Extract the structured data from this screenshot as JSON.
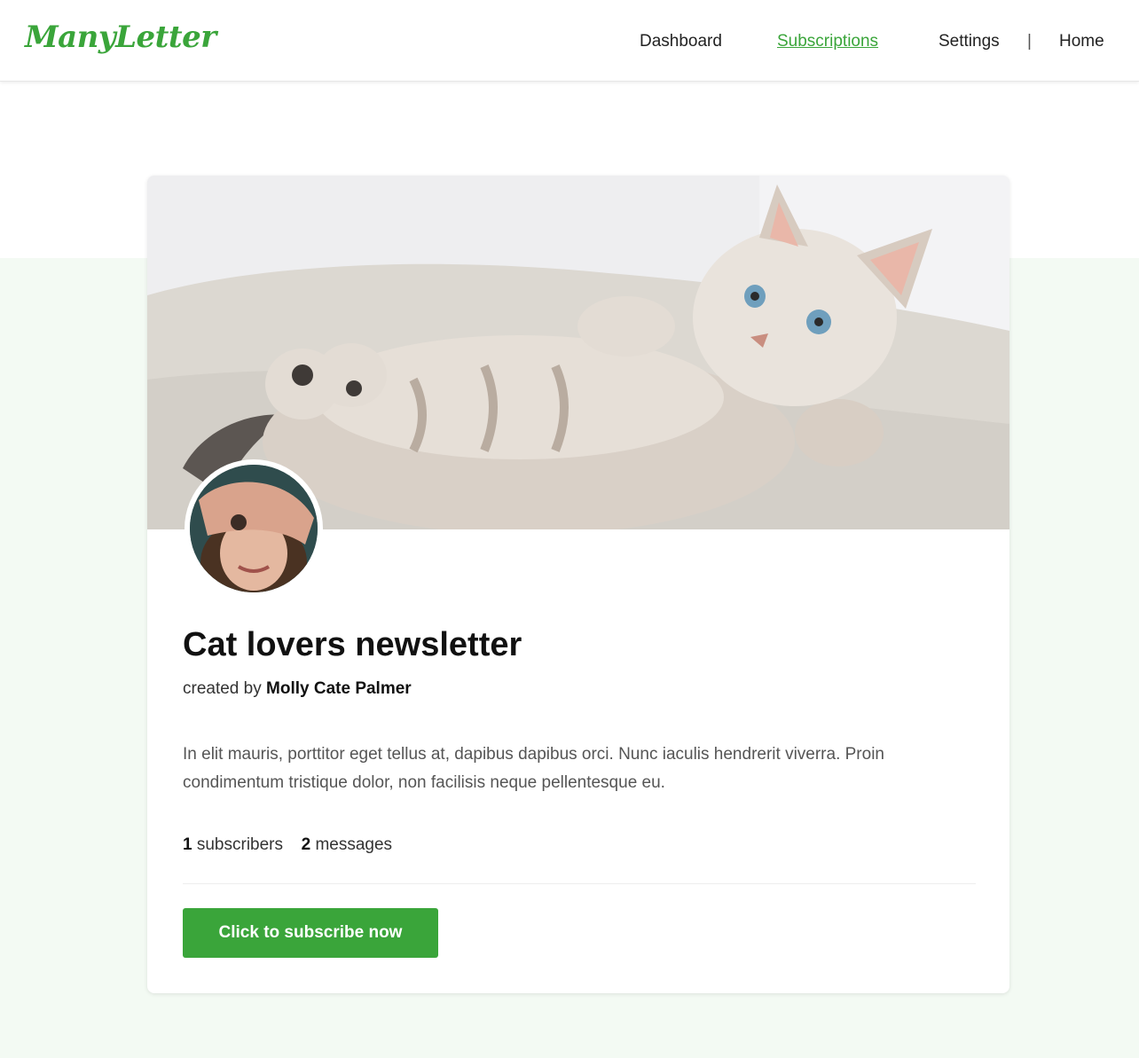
{
  "header": {
    "logo": "ManyLetter",
    "nav": {
      "dashboard": "Dashboard",
      "subscriptions": "Subscriptions",
      "settings": "Settings",
      "separator": "|",
      "home": "Home"
    },
    "active_tab": "Subscriptions"
  },
  "newsletter": {
    "cover_image": "kitten-cover-photo",
    "avatar_image": "author-avatar-photo",
    "title": "Cat lovers newsletter",
    "created_by_label": "created by",
    "author": "Molly Cate Palmer",
    "description": "In elit mauris, porttitor eget tellus at, dapibus dapibus orci. Nunc iaculis hendrerit viverra. Proin condimentum tristique dolor, non facilisis neque pellentesque eu.",
    "subscribers_count": "1",
    "subscribers_label": "subscribers",
    "messages_count": "2",
    "messages_label": "messages",
    "subscribe_button": "Click to subscribe now"
  },
  "colors": {
    "accent": "#3aa53a",
    "band_background": "#f3faf3"
  }
}
